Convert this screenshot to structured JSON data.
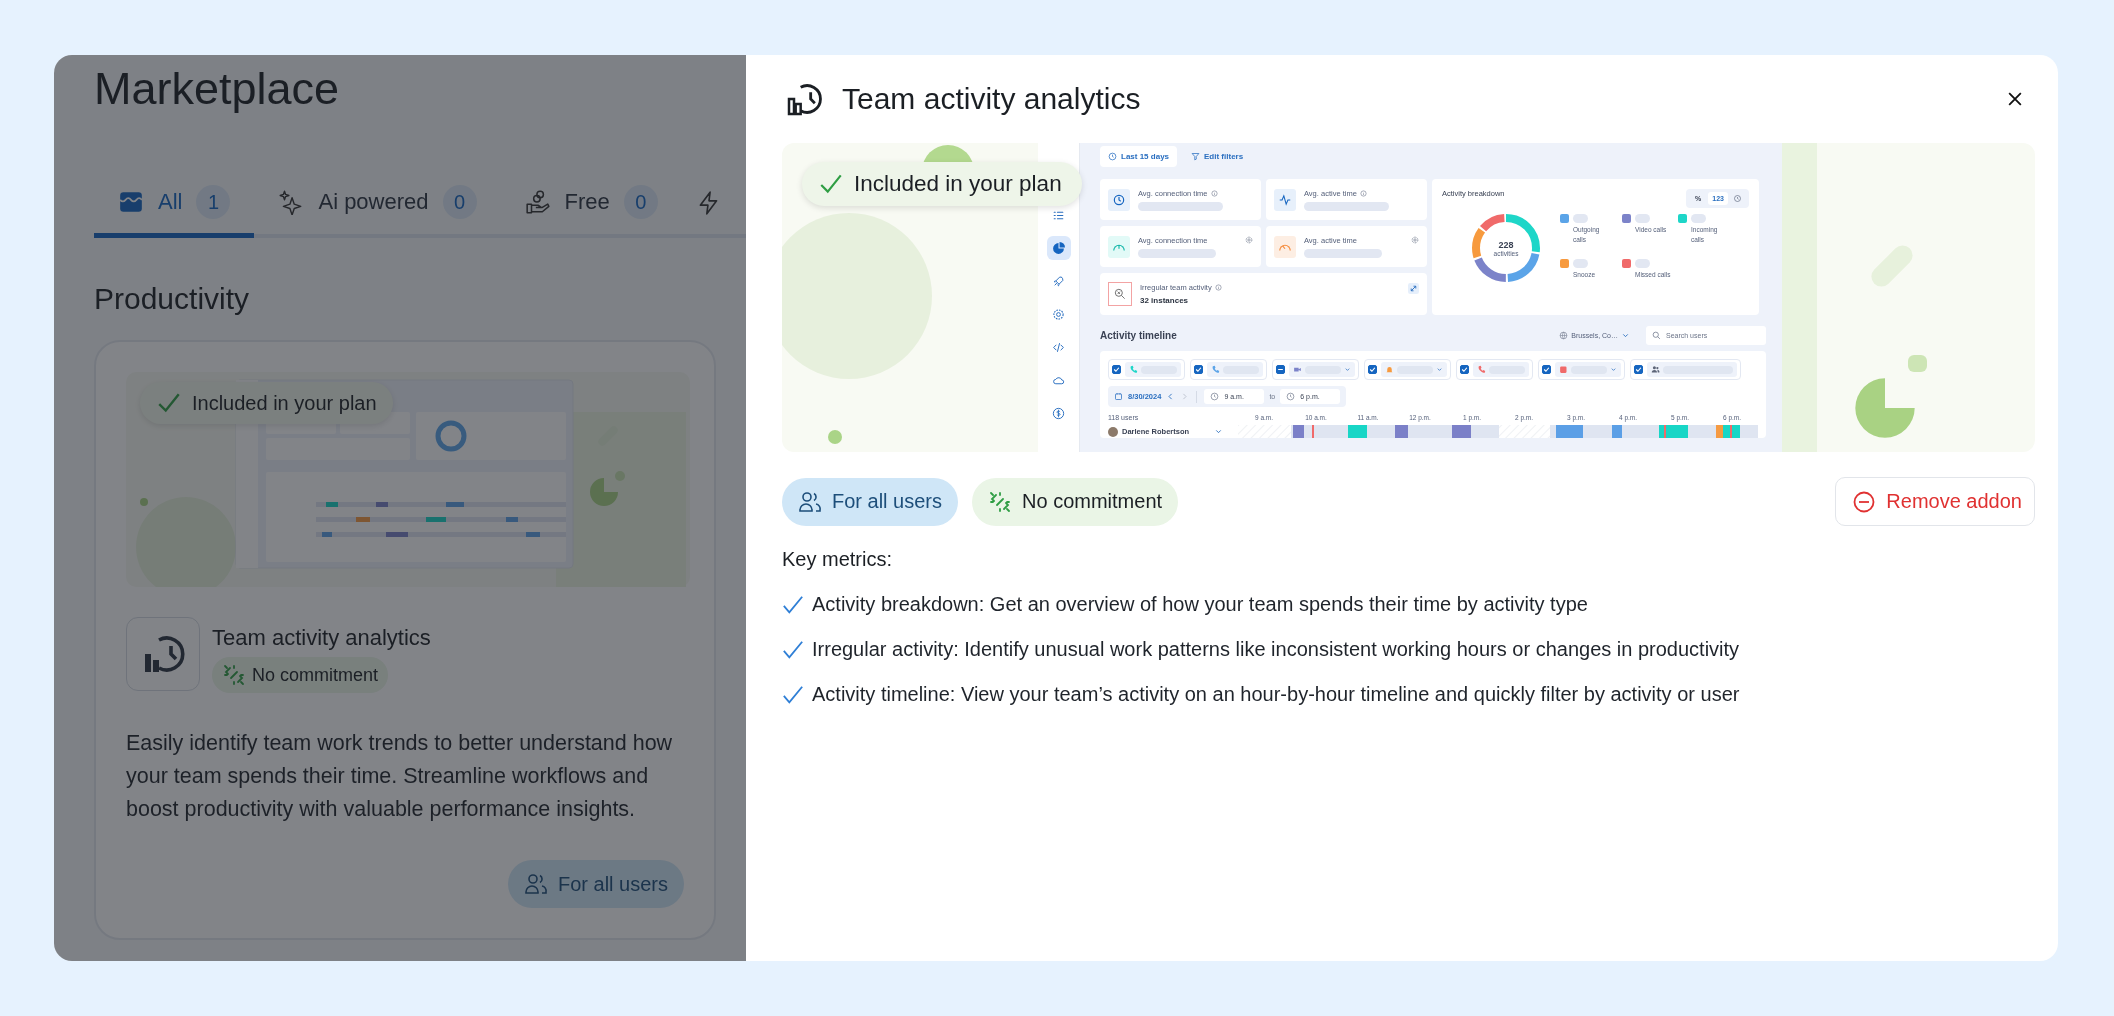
{
  "marketplace": {
    "title": "Marketplace",
    "tabs": [
      {
        "label": "All",
        "count": "1",
        "kind": "store",
        "selected": true
      },
      {
        "label": "Ai powered",
        "count": "0",
        "kind": "sparkles",
        "selected": false
      },
      {
        "label": "Free",
        "count": "0",
        "kind": "hand",
        "selected": false
      }
    ],
    "section": "Productivity",
    "card": {
      "badge": "Included in your plan",
      "title": "Team activity analytics",
      "tag": "No commitment",
      "description": "Easily identify team work trends to better understand how your team spends their time. Streamline workflows and boost productivity with valuable performance insights.",
      "audience": "For all users"
    }
  },
  "modal": {
    "title": "Team activity analytics",
    "preview": {
      "badge": "Included in your plan",
      "dashboard": {
        "nav": [
          {
            "kind": "list",
            "selected": false
          },
          {
            "kind": "pie",
            "selected": true
          },
          {
            "kind": "rocket",
            "selected": false
          },
          {
            "kind": "gear",
            "selected": false
          },
          {
            "kind": "code",
            "selected": false
          },
          {
            "kind": "cloud",
            "selected": false
          },
          {
            "kind": "dollar",
            "selected": false
          }
        ],
        "period": "Last 15 days",
        "filters": "Edit filters",
        "stats": [
          {
            "label": "Avg. connection time",
            "kind": "clock"
          },
          {
            "label": "Avg. active time",
            "kind": "pulse"
          },
          {
            "label": "Avg. connection time",
            "kind": "gauge"
          },
          {
            "label": "Avg. active time",
            "kind": "speedometer"
          }
        ],
        "irregular": {
          "label": "Irregular team activity",
          "value": "32 instances"
        },
        "breakdown": {
          "title": "Activity breakdown",
          "units": [
            {
              "label": "%",
              "selected": false
            },
            {
              "label": "123",
              "selected": true
            }
          ],
          "total": "228",
          "total_label": "activities",
          "legend": [
            {
              "label": "Outgoing calls",
              "color": "#5ba4e8"
            },
            {
              "label": "Video calls",
              "color": "#7c83c9"
            },
            {
              "label": "Incoming calls",
              "color": "#1ed6c8"
            },
            {
              "label": "Snooze",
              "color": "#f79a3e"
            },
            {
              "label": "Missed calls",
              "color": "#f06a6a"
            }
          ]
        },
        "timeline": {
          "title": "Activity timeline",
          "timezone": "Brussels, Co…",
          "search_placeholder": "Search users",
          "chips": [
            {
              "kind": "incoming",
              "checked": true,
              "indeterminate": false,
              "color": "#1ed6c8"
            },
            {
              "kind": "outgoing",
              "checked": true,
              "indeterminate": false,
              "color": "#5ba4e8"
            },
            {
              "kind": "video",
              "checked": true,
              "indeterminate": true,
              "color": "#7c83c9"
            },
            {
              "kind": "bell",
              "checked": true,
              "indeterminate": false,
              "color": "#f79a3e"
            },
            {
              "kind": "missed",
              "checked": true,
              "indeterminate": false,
              "color": "#f06a6a"
            },
            {
              "kind": "square",
              "checked": true,
              "indeterminate": false,
              "color": "#f06a6a"
            },
            {
              "kind": "people",
              "checked": true,
              "indeterminate": false,
              "color": "#5d6578"
            }
          ],
          "date": "8/30/2024",
          "from": "9 a.m.",
          "to_label": "to",
          "to": "6 p.m.",
          "users": "118 users",
          "hours": [
            "9 a.m.",
            "10 a.m.",
            "11 a.m.",
            "12 p.m.",
            "1 p.m.",
            "2 p.m.",
            "3 p.m.",
            "4 p.m.",
            "5 p.m.",
            "6 p.m."
          ],
          "rows": [
            {
              "name": "Darlene Robertson"
            }
          ]
        }
      }
    },
    "tags": [
      {
        "label": "For all users",
        "kind": "audience"
      },
      {
        "label": "No commitment",
        "kind": "commitment"
      }
    ],
    "remove_button": "Remove addon",
    "metrics_heading": "Key metrics:",
    "metrics": [
      "Activity breakdown: Get an overview of how your team spends their time by activity type",
      "Irregular activity: Identify unusual work patterns like inconsistent working hours or changes in productivity",
      "Activity timeline: View your team’s activity on an hour-by-hour timeline and quickly filter by activity or user"
    ]
  }
}
